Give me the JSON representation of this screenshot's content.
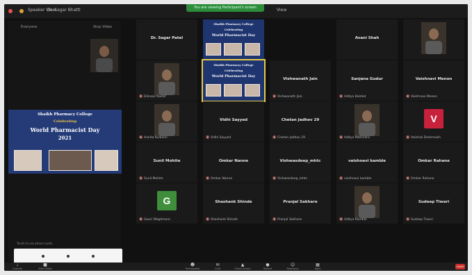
{
  "window": {
    "title": "Dr. Sagar Bhattl",
    "left_label": "Speaker View",
    "right_label": "View"
  },
  "banner": {
    "text": "You are viewing Participant's screen"
  },
  "left_panel": {
    "header_left": "Everyone",
    "header_right": "Stop Video",
    "phone_caption": "Touch to use phone audio",
    "share": {
      "line1": "Shaikh Pharmacy College",
      "line2": "Celebrating",
      "line3": "World Pharmacist Day",
      "line4": "2021"
    }
  },
  "tiles": [
    {
      "name": "Dr. Sagar Patel",
      "sub": "",
      "type": "name"
    },
    {
      "name": "",
      "sub": "",
      "type": "screen"
    },
    {
      "name": "Avani Shah",
      "sub": "",
      "type": "name"
    },
    {
      "name": "Aditya Bhattar",
      "sub": "",
      "type": "video"
    },
    {
      "name": "",
      "sub": "Dilnaaz Nadaf",
      "type": "video"
    },
    {
      "name": "",
      "sub": "",
      "type": "screen_active"
    },
    {
      "name": "Vishwanath Jain",
      "sub": "Vishwanath Jain",
      "type": "name"
    },
    {
      "name": "Sanjana Gudur",
      "sub": "Aditya Baldod",
      "type": "name"
    },
    {
      "name": "Vaishnavi Menon",
      "sub": "Vaishnavi Menon",
      "type": "name"
    },
    {
      "name": "",
      "sub": "Ankita Kulkarni",
      "type": "video"
    },
    {
      "name": "Vidhi Sayyed",
      "sub": "Vidhi Sayyed",
      "type": "name"
    },
    {
      "name": "Chetan Jadhav 29",
      "sub": "Chetan Jadhav 29",
      "type": "name"
    },
    {
      "name": "",
      "sub": "Aditya Mahindra",
      "type": "video"
    },
    {
      "name": "V",
      "sub": "Vaishali Deshmukh",
      "type": "avatar",
      "color": "#c8213c"
    },
    {
      "name": "Sunil Mohite",
      "sub": "Sunil Mohite",
      "type": "name"
    },
    {
      "name": "Omkar Nanne",
      "sub": "Omkar Nanne",
      "type": "name"
    },
    {
      "name": "Vishwasdeep_mhtc",
      "sub": "Vishwasdeep_mhtc",
      "type": "name"
    },
    {
      "name": "vaishnavi kamble",
      "sub": "vaishnavi kamble",
      "type": "name"
    },
    {
      "name": "Omkar Rahane",
      "sub": "Omkar Rahane",
      "type": "name"
    },
    {
      "name": "G",
      "sub": "Gauri Waghmare",
      "type": "avatar",
      "color": "#3f8e3c"
    },
    {
      "name": "Shashank Shinde",
      "sub": "Shashank Shinde",
      "type": "name"
    },
    {
      "name": "Pranjal Sakhare",
      "sub": "Pranjal Sakhare",
      "type": "name"
    },
    {
      "name": "",
      "sub": "Aditya Kamble",
      "type": "video"
    },
    {
      "name": "Sudeep Tiwari",
      "sub": "Sudeep Tiwari",
      "type": "name"
    }
  ],
  "toolbar": {
    "items": [
      {
        "label": "Participants",
        "icon": "participants-icon"
      },
      {
        "label": "Chat",
        "icon": "chat-icon"
      },
      {
        "label": "Share Screen",
        "icon": "share-screen-icon"
      },
      {
        "label": "Record",
        "icon": "record-icon"
      },
      {
        "label": "Reactions",
        "icon": "reactions-icon"
      },
      {
        "label": "Apps",
        "icon": "apps-icon"
      }
    ],
    "left_items": [
      {
        "label": "Unmute",
        "icon": "mic-icon"
      },
      {
        "label": "Start Video",
        "icon": "video-icon"
      }
    ],
    "leave_label": "Leave"
  }
}
